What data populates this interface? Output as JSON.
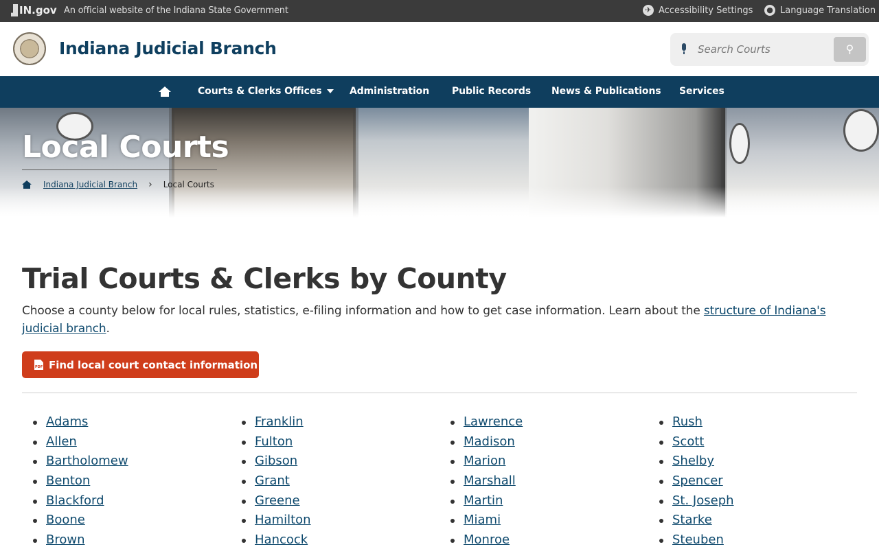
{
  "govbar": {
    "logo": "IN.gov",
    "official_text": "An official website of the Indiana State Government",
    "accessibility": "Accessibility Settings",
    "translation": "Language Translation"
  },
  "header": {
    "title": "Indiana Judicial Branch",
    "search_placeholder": "Search Courts"
  },
  "nav": {
    "items": [
      "Courts & Clerks Offices",
      "Administration",
      "Public Records",
      "News & Publications",
      "Services"
    ]
  },
  "hero": {
    "title": "Local Courts",
    "breadcrumb": [
      "Indiana Judicial Branch",
      "Local Courts"
    ]
  },
  "main": {
    "heading": "Trial Courts & Clerks by County",
    "intro_text": "Choose a county below for local rules, statistics, e-filing information and how to get case information. Learn about the ",
    "intro_link": "structure of Indiana's judicial branch",
    "intro_end": ".",
    "cta_label": "Find local court contact information"
  },
  "counties": {
    "col1": [
      "Adams",
      "Allen",
      "Bartholomew",
      "Benton",
      "Blackford",
      "Boone",
      "Brown"
    ],
    "col2": [
      "Franklin",
      "Fulton",
      "Gibson",
      "Grant",
      "Greene",
      "Hamilton",
      "Hancock"
    ],
    "col3": [
      "Lawrence",
      "Madison",
      "Marion",
      "Marshall",
      "Martin",
      "Miami",
      "Monroe"
    ],
    "col4": [
      "Rush",
      "Scott",
      "Shelby",
      "Spencer",
      "St. Joseph",
      "Starke",
      "Steuben"
    ]
  },
  "colors": {
    "navy": "#0f3e5e",
    "cta": "#cf3d1b",
    "govbar": "#3b3b3b"
  }
}
